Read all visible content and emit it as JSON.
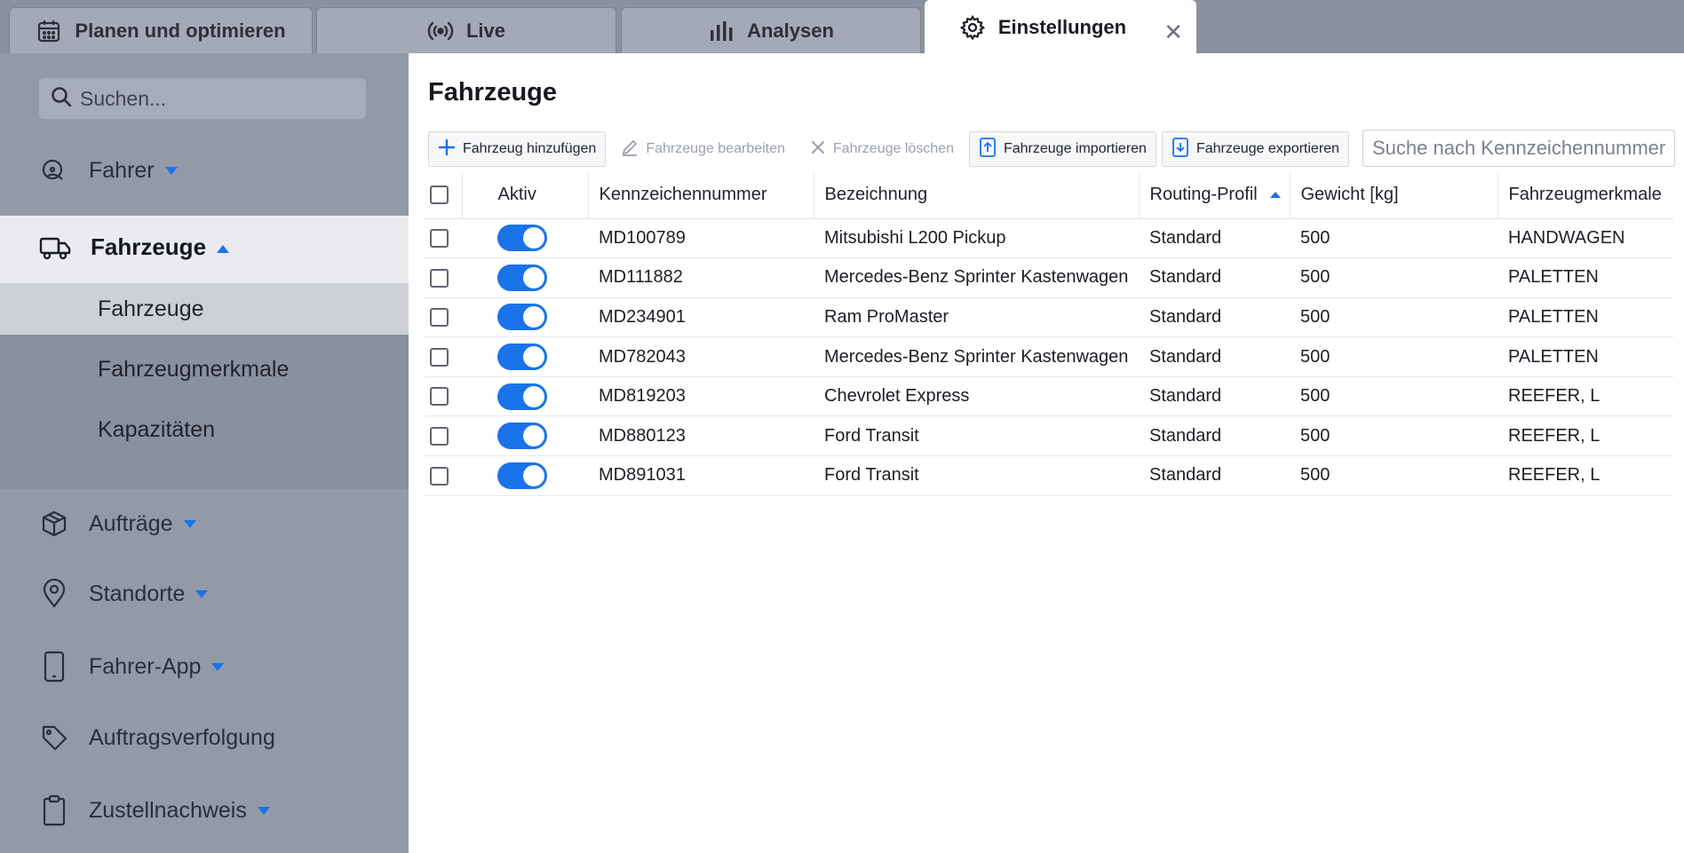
{
  "tabs": [
    {
      "label": "Planen und optimieren",
      "icon": "calendar-icon"
    },
    {
      "label": "Live",
      "icon": "broadcast-icon"
    },
    {
      "label": "Analysen",
      "icon": "bar-chart-icon"
    },
    {
      "label": "Einstellungen",
      "icon": "gear-icon",
      "active": true
    }
  ],
  "sidebar": {
    "search_placeholder": "Suchen...",
    "items": [
      {
        "label": "Fahrer",
        "icon": "driver-icon"
      },
      {
        "label": "Fahrzeuge",
        "icon": "truck-icon",
        "expanded": true
      },
      {
        "label": "Aufträge",
        "icon": "box-icon"
      },
      {
        "label": "Standorte",
        "icon": "location-pin-icon"
      },
      {
        "label": "Fahrer-App",
        "icon": "phone-icon"
      },
      {
        "label": "Auftragsverfolgung",
        "icon": "tag-icon"
      },
      {
        "label": "Zustellnachweis",
        "icon": "clipboard-icon"
      }
    ],
    "subitems": [
      {
        "label": "Fahrzeuge",
        "selected": true
      },
      {
        "label": "Fahrzeugmerkmale"
      },
      {
        "label": "Kapazitäten"
      }
    ]
  },
  "main": {
    "title": "Fahrzeuge",
    "toolbar": {
      "add": "Fahrzeug hinzufügen",
      "edit": "Fahrzeuge bearbeiten",
      "delete": "Fahrzeuge löschen",
      "import": "Fahrzeuge importieren",
      "export": "Fahrzeuge exportieren"
    },
    "search_placeholder": "Suche nach Kennzeichennummer",
    "table": {
      "columns": [
        "Aktiv",
        "Kennzeichennummer",
        "Bezeichnung",
        "Routing-Profil",
        "Gewicht [kg]",
        "Fahrzeugmerkmale"
      ],
      "rows": [
        {
          "plate": "MD100789",
          "name": "Mitsubishi L200 Pickup",
          "profile": "Standard",
          "weight": "500",
          "features": "HANDWAGEN",
          "active": true
        },
        {
          "plate": "MD111882",
          "name": "Mercedes-Benz Sprinter Kastenwagen",
          "profile": "Standard",
          "weight": "500",
          "features": "PALETTEN",
          "active": true
        },
        {
          "plate": "MD234901",
          "name": "Ram ProMaster",
          "profile": "Standard",
          "weight": "500",
          "features": "PALETTEN",
          "active": true
        },
        {
          "plate": "MD782043",
          "name": "Mercedes-Benz Sprinter Kastenwagen",
          "profile": "Standard",
          "weight": "500",
          "features": "PALETTEN",
          "active": true
        },
        {
          "plate": "MD819203",
          "name": "Chevrolet Express",
          "profile": "Standard",
          "weight": "500",
          "features": "REEFER, L",
          "active": true
        },
        {
          "plate": "MD880123",
          "name": "Ford Transit",
          "profile": "Standard",
          "weight": "500",
          "features": "REEFER, L",
          "active": true
        },
        {
          "plate": "MD891031",
          "name": "Ford Transit",
          "profile": "Standard",
          "weight": "500",
          "features": "REEFER, L",
          "active": true
        }
      ]
    }
  },
  "colors": {
    "accent": "#1a73e8",
    "sidebar": "#939aa7",
    "tabbar": "#8b929f"
  }
}
